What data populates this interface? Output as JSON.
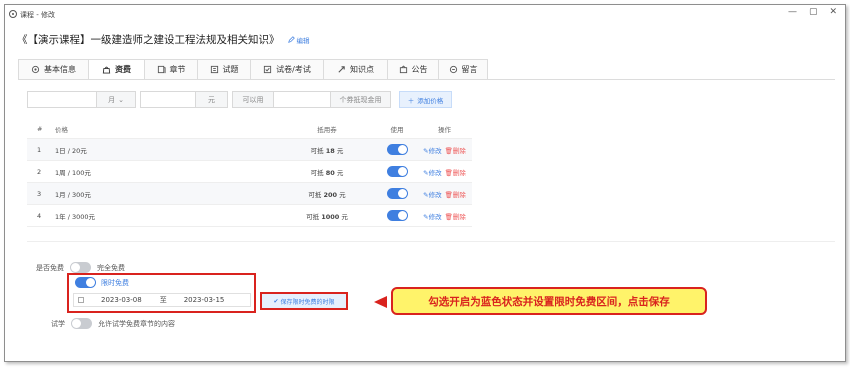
{
  "window": {
    "title": "课程 - 修改",
    "controls": [
      "—",
      "▢",
      "✕"
    ]
  },
  "header": {
    "prefix": "《",
    "title": "【演示课程】一级建造师之建设工程法规及相关知识",
    "suffix": "》",
    "edit_label": "编辑"
  },
  "tabs": [
    {
      "label": "基本信息",
      "icon": "gear-icon"
    },
    {
      "label": "资费",
      "icon": "bag-icon"
    },
    {
      "label": "章节",
      "icon": "chapter-icon"
    },
    {
      "label": "试题",
      "icon": "book-icon"
    },
    {
      "label": "试卷/考试",
      "icon": "exam-icon"
    },
    {
      "label": "知识点",
      "icon": "knowledge-icon"
    },
    {
      "label": "公告",
      "icon": "notice-icon"
    },
    {
      "label": "留言",
      "icon": "message-icon"
    }
  ],
  "filter": {
    "period_value": "",
    "period_unit": "月",
    "price_value": "",
    "price_unit": "元",
    "coupon_label": "可以用",
    "coupon_value": "",
    "coupon_suffix": "个券抵现金用",
    "add_price_label": "添加价格"
  },
  "table": {
    "headers": {
      "idx": "#",
      "price": "价格",
      "coupon": "抵用券",
      "use": "使用",
      "op": "操作"
    },
    "rows": [
      {
        "idx": "1",
        "price": "1日 / 20元",
        "coupon_prefix": "可抵",
        "coupon_amount": "18",
        "coupon_unit": "元",
        "enabled": true,
        "edit": "修改",
        "delete": "删除"
      },
      {
        "idx": "2",
        "price": "1周 / 100元",
        "coupon_prefix": "可抵",
        "coupon_amount": "80",
        "coupon_unit": "元",
        "enabled": true,
        "edit": "修改",
        "delete": "删除"
      },
      {
        "idx": "3",
        "price": "1月 / 300元",
        "coupon_prefix": "可抵",
        "coupon_amount": "200",
        "coupon_unit": "元",
        "enabled": true,
        "edit": "修改",
        "delete": "删除"
      },
      {
        "idx": "4",
        "price": "1年 / 3000元",
        "coupon_prefix": "可抵",
        "coupon_amount": "1000",
        "coupon_unit": "元",
        "enabled": true,
        "edit": "修改",
        "delete": "删除"
      }
    ]
  },
  "free": {
    "label": "是否免费",
    "full_free_label": "完全免费",
    "full_free_on": false,
    "limited_free_label": "限时免费",
    "limited_free_on": true,
    "start_date": "2023-03-08",
    "range_sep": "至",
    "end_date": "2023-03-15",
    "save_label": "保存限时免费的时限"
  },
  "trial": {
    "label": "试学",
    "toggle_label": "允许试学免费章节的内容",
    "on": false
  },
  "callout": {
    "text": "勾选开启为蓝色状态并设置限时免费区间，点击保存"
  },
  "colors": {
    "accent": "#3f7fe0",
    "highlight_red": "#d9231e",
    "callout_bg": "#fff36a"
  }
}
